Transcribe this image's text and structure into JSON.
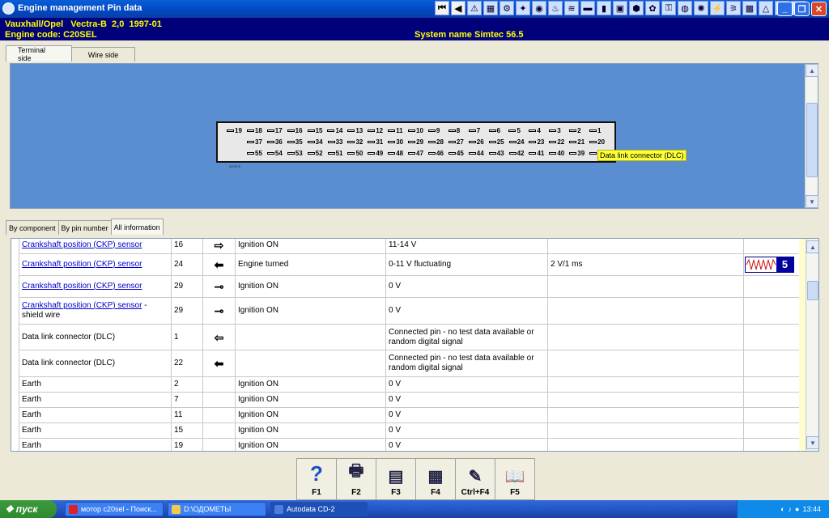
{
  "window": {
    "title": "Engine management Pin data"
  },
  "header": {
    "vehicle": "Vauxhall/Opel   Vectra-B  2,0  1997-01",
    "engine_code": "Engine code: C20SEL",
    "system_name": "System name Simtec 56.5"
  },
  "view_tabs": [
    {
      "label": "Terminal side",
      "active": true
    },
    {
      "label": "Wire side",
      "active": false
    }
  ],
  "connector": {
    "rows": [
      [
        "19",
        "18",
        "17",
        "16",
        "15",
        "14",
        "13",
        "12",
        "11",
        "10",
        "9",
        "8",
        "7",
        "6",
        "5",
        "4",
        "3",
        "2",
        "1"
      ],
      [
        "37",
        "36",
        "35",
        "34",
        "33",
        "32",
        "31",
        "30",
        "29",
        "28",
        "27",
        "26",
        "25",
        "24",
        "23",
        "22",
        "21",
        "20"
      ],
      [
        "55",
        "54",
        "53",
        "52",
        "51",
        "50",
        "49",
        "48",
        "47",
        "46",
        "45",
        "44",
        "43",
        "42",
        "41",
        "40",
        "39",
        "38"
      ]
    ],
    "code": "A0?6?6",
    "tooltip": "Data link connector (DLC)"
  },
  "list_tabs": [
    {
      "label": "By component",
      "active": false
    },
    {
      "label": "By pin number",
      "active": false
    },
    {
      "label": "All information",
      "active": true
    }
  ],
  "table": {
    "rows": [
      {
        "component": "Crankshaft position (CKP) sensor",
        "suffix": "",
        "link": true,
        "pin": "16",
        "arrow": "⇨",
        "condition": "Ignition ON",
        "value": "11-14 V",
        "setting": "",
        "wave": ""
      },
      {
        "component": "Crankshaft position (CKP) sensor",
        "suffix": "",
        "link": true,
        "pin": "24",
        "arrow": "⬅",
        "condition": "Engine turned",
        "value": "0-11 V fluctuating",
        "setting": "2 V/1 ms",
        "wave": "5"
      },
      {
        "component": "Crankshaft position (CKP) sensor",
        "suffix": "",
        "link": true,
        "pin": "29",
        "arrow": "⊸",
        "condition": "Ignition ON",
        "value": "0 V",
        "setting": "",
        "wave": ""
      },
      {
        "component": "Crankshaft position (CKP) sensor",
        "suffix": " - shield wire",
        "link": true,
        "pin": "29",
        "arrow": "⊸",
        "condition": "Ignition ON",
        "value": "0 V",
        "setting": "",
        "wave": ""
      },
      {
        "component": "Data link connector (DLC)",
        "suffix": "",
        "link": false,
        "pin": "1",
        "arrow": "⇦",
        "condition": "",
        "value": "Connected pin - no test data available or random digital signal",
        "setting": "",
        "wave": ""
      },
      {
        "component": "Data link connector (DLC)",
        "suffix": "",
        "link": false,
        "pin": "22",
        "arrow": "⬅",
        "condition": "",
        "value": "Connected pin - no test data available or random digital signal",
        "setting": "",
        "wave": ""
      },
      {
        "component": "Earth",
        "suffix": "",
        "link": false,
        "pin": "2",
        "arrow": "",
        "condition": "Ignition ON",
        "value": "0 V",
        "setting": "",
        "wave": ""
      },
      {
        "component": "Earth",
        "suffix": "",
        "link": false,
        "pin": "7",
        "arrow": "",
        "condition": "Ignition ON",
        "value": "0 V",
        "setting": "",
        "wave": ""
      },
      {
        "component": "Earth",
        "suffix": "",
        "link": false,
        "pin": "11",
        "arrow": "",
        "condition": "Ignition ON",
        "value": "0 V",
        "setting": "",
        "wave": ""
      },
      {
        "component": "Earth",
        "suffix": "",
        "link": false,
        "pin": "15",
        "arrow": "",
        "condition": "Ignition ON",
        "value": "0 V",
        "setting": "",
        "wave": ""
      },
      {
        "component": "Earth",
        "suffix": "",
        "link": false,
        "pin": "19",
        "arrow": "",
        "condition": "Ignition ON",
        "value": "0 V",
        "setting": "",
        "wave": ""
      }
    ]
  },
  "function_keys": [
    {
      "label": "F1",
      "icon": "help-icon",
      "glyph": "?"
    },
    {
      "label": "F2",
      "icon": "print-icon",
      "glyph": "🖶"
    },
    {
      "label": "F3",
      "icon": "print-preview-icon",
      "glyph": "▤"
    },
    {
      "label": "F4",
      "icon": "print-list-icon",
      "glyph": "▦"
    },
    {
      "label": "Ctrl+F4",
      "icon": "notepad-icon",
      "glyph": "✎"
    },
    {
      "label": "F5",
      "icon": "book-icon",
      "glyph": "📖"
    }
  ],
  "taskbar": {
    "start_label": "пуск",
    "tasks": [
      {
        "label": "мотор c20sel - Поиск...",
        "active": false,
        "color": "#d8232a"
      },
      {
        "label": "D:\\ОДОМЕТЫ",
        "active": false,
        "color": "#f2c94c"
      },
      {
        "label": "Autodata CD-2",
        "active": true,
        "color": "#4a7fe0"
      }
    ],
    "clock": "13:44"
  }
}
